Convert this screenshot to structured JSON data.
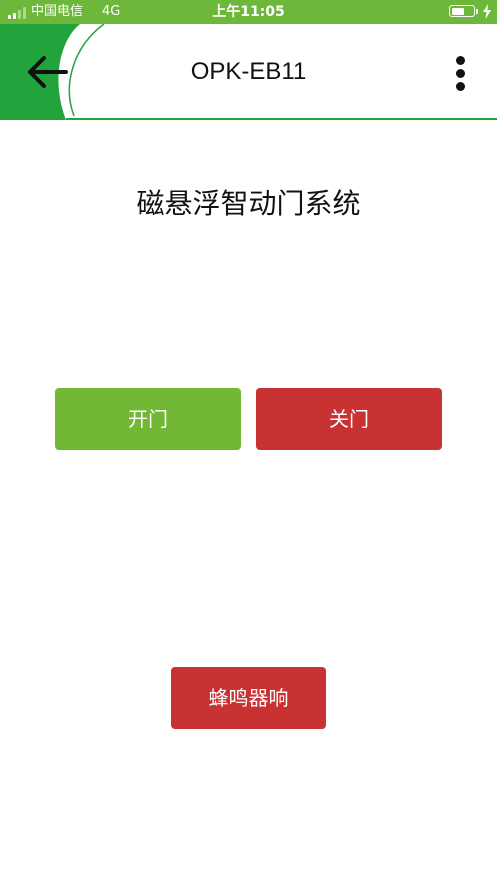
{
  "status_bar": {
    "carrier": "中国电信",
    "network": "4G",
    "time": "上午11:05",
    "battery_level": 0.6
  },
  "header": {
    "title": "OPK-EB11",
    "back_icon": "arrow-left-icon",
    "menu_icon": "more-vertical-icon"
  },
  "main": {
    "system_title": "磁悬浮智动门系统",
    "open_door_label": "开门",
    "close_door_label": "关门",
    "buzzer_label": "蜂鸣器响"
  },
  "colors": {
    "status_bar": "#6db83a",
    "header_green": "#23a33b",
    "open_button": "#72b836",
    "close_button": "#c83232",
    "buzzer_button": "#c83232"
  }
}
